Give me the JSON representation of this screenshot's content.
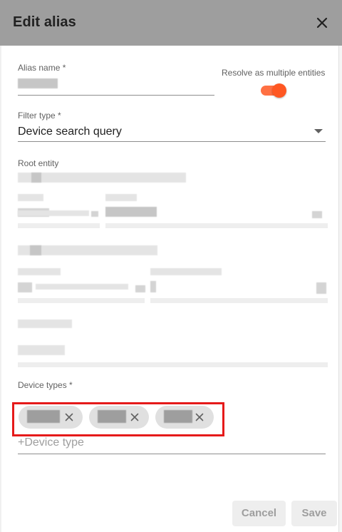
{
  "dialog": {
    "title": "Edit alias",
    "close_icon": "close-icon"
  },
  "alias_name": {
    "label": "Alias name *",
    "value": ""
  },
  "resolve_multiple": {
    "label": "Resolve as multiple entities",
    "checked": true,
    "accent": "#ff5722"
  },
  "filter_type": {
    "label": "Filter type *",
    "value": "Device search query"
  },
  "root_entity": {
    "label": "Root entity"
  },
  "device_types": {
    "label": "Device types *",
    "chips": [
      "",
      "",
      ""
    ],
    "placeholder": "+Device type",
    "highlight_color": "#e51a1a"
  },
  "actions": {
    "cancel_label": "Cancel",
    "save_label": "Save"
  }
}
